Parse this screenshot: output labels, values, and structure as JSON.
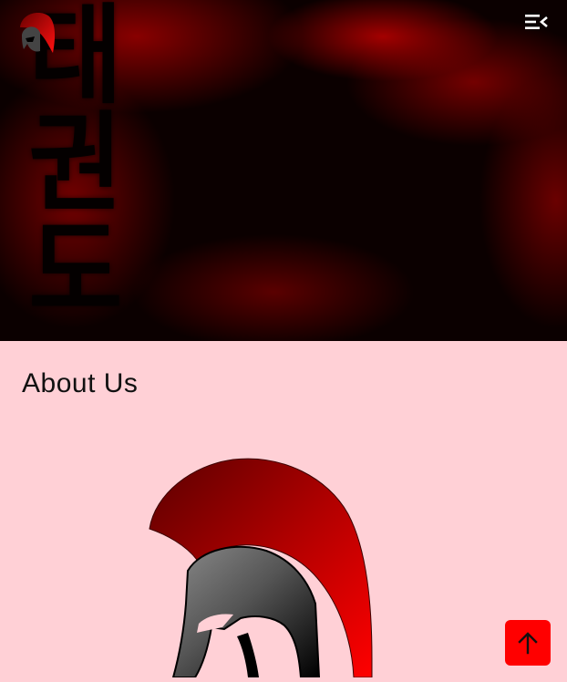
{
  "hero": {
    "calligraphy": [
      "태",
      "권",
      "도"
    ]
  },
  "header": {
    "logo_icon": "spartan-helmet-logo",
    "menu_icon": "menu-collapse-icon"
  },
  "main": {
    "title": "About Us",
    "image_icon": "spartan-helmet"
  },
  "controls": {
    "back_to_top_icon": "arrow-up-icon"
  },
  "colors": {
    "accent": "#ff0000",
    "page_background": "#ffd0d6",
    "hero_dark": "#0b0000",
    "hero_red": "#b00000"
  }
}
